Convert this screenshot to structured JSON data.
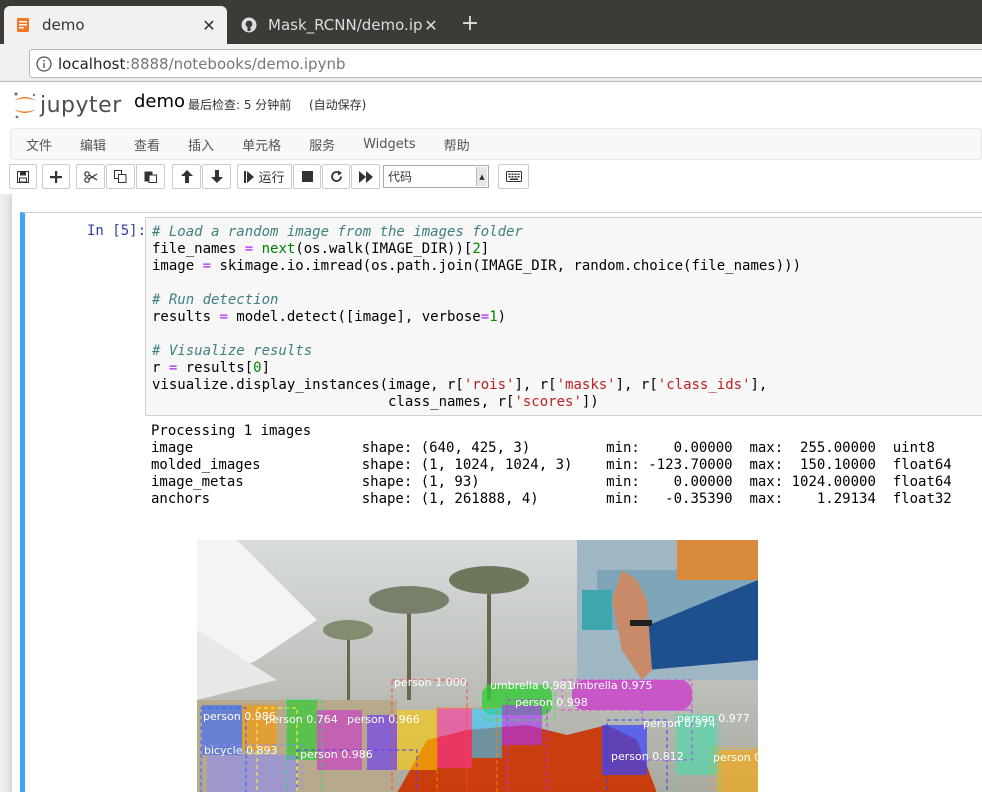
{
  "browser": {
    "tabs": [
      {
        "title": "demo",
        "icon": "jupyter-icon",
        "active": true
      },
      {
        "title": "Mask_RCNN/demo.ipynb",
        "icon": "github-icon",
        "active": false
      }
    ],
    "url_host": "localhost",
    "url_rest": ":8888/notebooks/demo.ipynb"
  },
  "jupyter": {
    "logo_text": "jupyter",
    "notebook_name": "demo",
    "checkpoint": "最后检查: 5 分钟前",
    "autosave": "(自动保存)",
    "menu": [
      "文件",
      "编辑",
      "查看",
      "插入",
      "单元格",
      "服务",
      "Widgets",
      "帮助"
    ],
    "toolbar": {
      "run_label": "运行",
      "cell_type": "代码"
    }
  },
  "cell": {
    "prompt": "In [5]:",
    "code_lines": [
      "# Load a random image from the images folder",
      "file_names = next(os.walk(IMAGE_DIR))[2]",
      "image = skimage.io.imread(os.path.join(IMAGE_DIR, random.choice(file_names)))",
      "",
      "# Run detection",
      "results = model.detect([image], verbose=1)",
      "",
      "# Visualize results",
      "r = results[0]",
      "visualize.display_instances(image, r['rois'], r['masks'], r['class_ids'],",
      "                            class_names, r['scores'])"
    ],
    "output_lines": [
      "Processing 1 images",
      "image                    shape: (640, 425, 3)         min:    0.00000  max:  255.00000  uint8",
      "molded_images            shape: (1, 1024, 1024, 3)    min: -123.70000  max:  150.10000  float64",
      "image_metas              shape: (1, 93)               min:    0.00000  max: 1024.00000  float64",
      "anchors                  shape: (1, 261888, 4)        min:   -0.35390  max:    1.29134  float32"
    ]
  },
  "detections": [
    {
      "label": "person 1.000",
      "color": "#ff4444"
    },
    {
      "label": "umbrella 0.981",
      "color": "#44dd44"
    },
    {
      "label": "umbrella 0.975",
      "color": "#dd44dd"
    },
    {
      "label": "person 0.986",
      "color": "#2266ff"
    },
    {
      "label": "person 0.998",
      "color": "#ff8800"
    },
    {
      "label": "person 0.977",
      "color": "#44ddaa"
    },
    {
      "label": "person 0.974",
      "color": "#aa44ff"
    },
    {
      "label": "person 0.812",
      "color": "#3344ff"
    },
    {
      "label": "bicycle 0.893",
      "color": "#8888ff"
    },
    {
      "label": "person 0.986",
      "color": "#6633ff"
    },
    {
      "label": "person 0.764",
      "color": "#ffff33"
    },
    {
      "label": "person 0.966",
      "color": "#22dd66"
    },
    {
      "label": "person 0",
      "color": "#ffaa00"
    }
  ]
}
